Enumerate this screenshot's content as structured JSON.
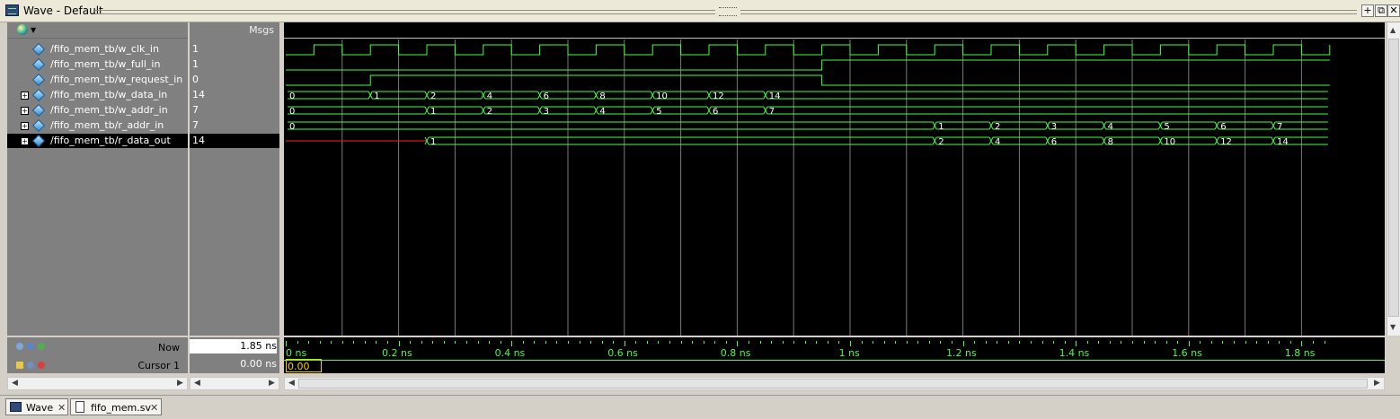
{
  "window": {
    "title": "Wave - Default"
  },
  "header": {
    "msgs_label": "Msgs"
  },
  "signals": [
    {
      "name": "/fifo_mem_tb/w_clk_in",
      "value": "1",
      "expandable": false
    },
    {
      "name": "/fifo_mem_tb/w_full_in",
      "value": "1",
      "expandable": false
    },
    {
      "name": "/fifo_mem_tb/w_request_in",
      "value": "0",
      "expandable": false
    },
    {
      "name": "/fifo_mem_tb/w_data_in",
      "value": "14",
      "expandable": true
    },
    {
      "name": "/fifo_mem_tb/w_addr_in",
      "value": "7",
      "expandable": true
    },
    {
      "name": "/fifo_mem_tb/r_addr_in",
      "value": "7",
      "expandable": true
    },
    {
      "name": "/fifo_mem_tb/r_data_out",
      "value": "14",
      "expandable": true,
      "selected": true
    }
  ],
  "waves": {
    "bus_labels": {
      "w_data_in": [
        "0",
        "1",
        "2",
        "4",
        "6",
        "8",
        "10",
        "12",
        "14"
      ],
      "w_addr_in": [
        "0",
        "1",
        "2",
        "3",
        "4",
        "5",
        "6",
        "7"
      ],
      "r_addr_in": [
        "0",
        "1",
        "2",
        "3",
        "4",
        "5",
        "6",
        "7"
      ],
      "r_data_out": [
        "1",
        "2",
        "4",
        "6",
        "8",
        "10",
        "12",
        "14"
      ]
    }
  },
  "status": {
    "now_label": "Now",
    "now_value": "1.85 ns",
    "cursor_label": "Cursor 1",
    "cursor_value": "0.00 ns",
    "cursor_time_box": "0.00 ns"
  },
  "ruler": {
    "labels": [
      "0 ns",
      "0.2 ns",
      "0.4 ns",
      "0.6 ns",
      "0.8 ns",
      "1 ns",
      "1.2 ns",
      "1.4 ns",
      "1.6 ns",
      "1.8 ns"
    ]
  },
  "tabs": [
    {
      "label": "Wave",
      "icon": "wave-icon",
      "active": true
    },
    {
      "label": "fifo_mem.sv",
      "icon": "file-icon",
      "active": false
    }
  ],
  "colors": {
    "wave": "#40ff40",
    "undefined": "#ff2020",
    "background": "#000000"
  }
}
